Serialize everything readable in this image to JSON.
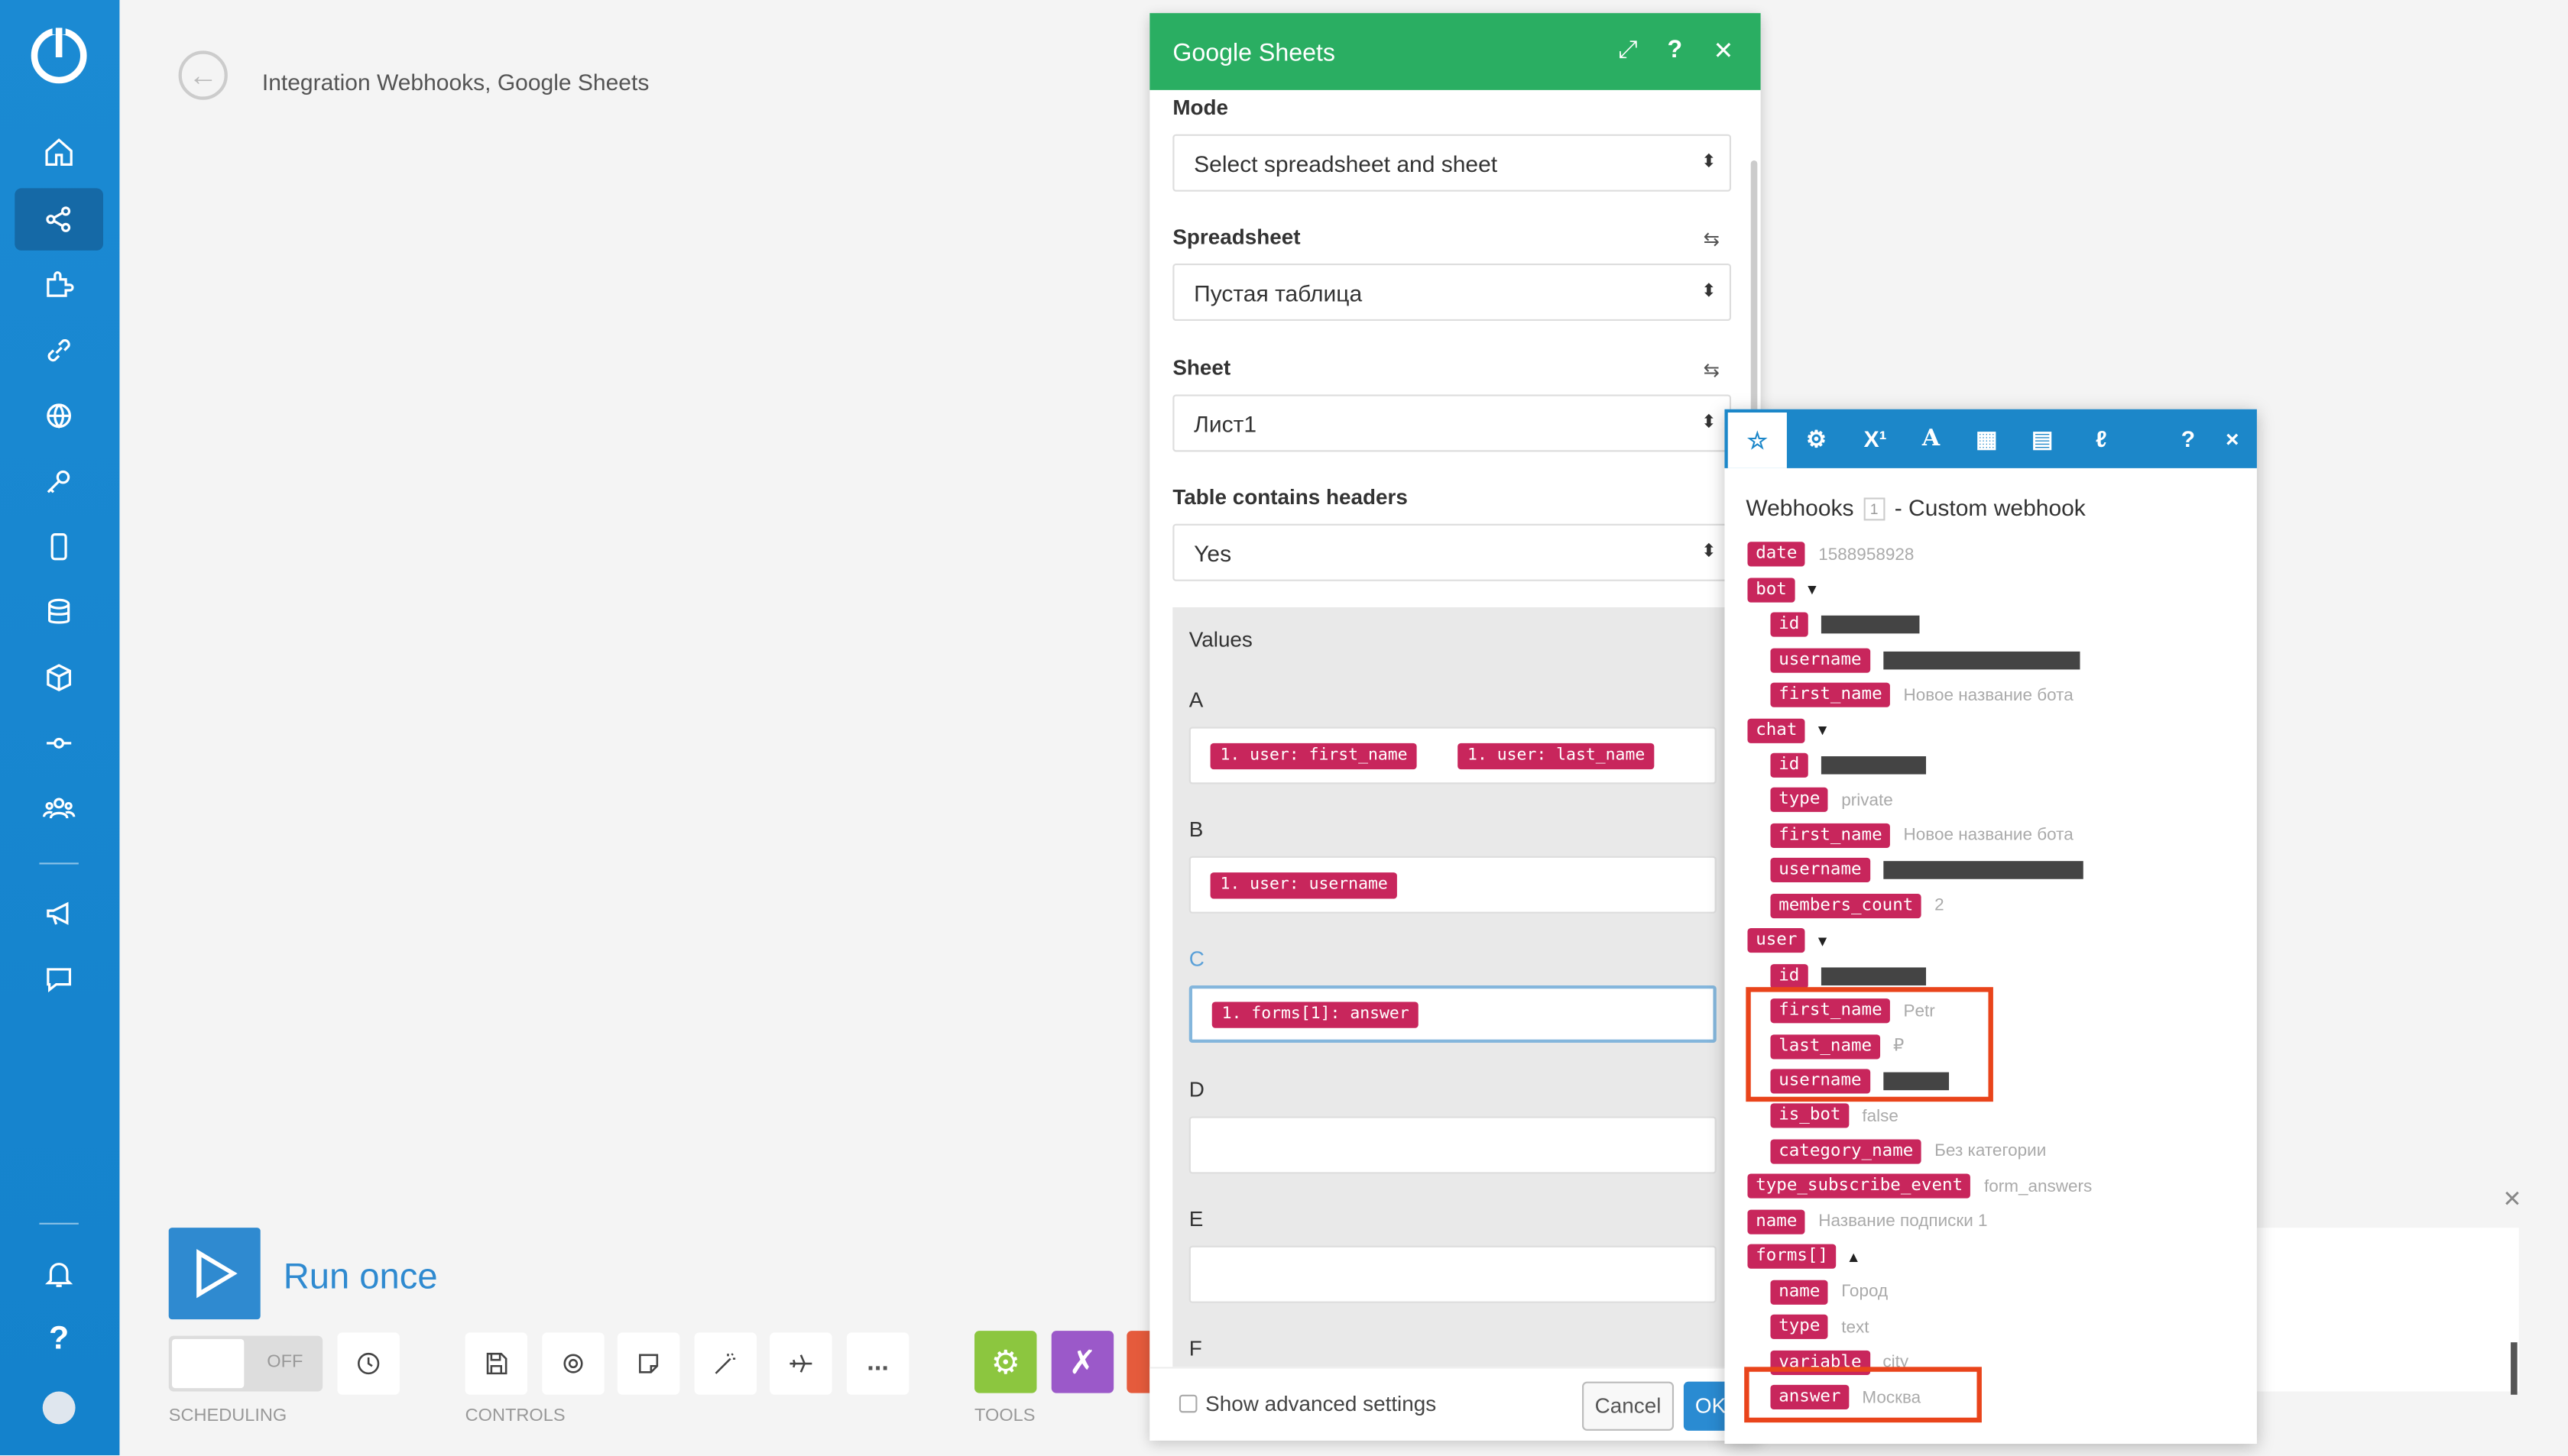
{
  "breadcrumb": "Integration Webhooks, Google Sheets",
  "sidebar": {
    "items": [
      "home-icon",
      "share-icon",
      "puzzle-icon",
      "link-icon",
      "globe-icon",
      "key-icon",
      "device-icon",
      "database-icon",
      "cube-icon",
      "flow-icon",
      "team-icon",
      "megaphone-icon",
      "chat-icon",
      "bell-icon",
      "help-icon",
      "avatar-icon"
    ],
    "help_label": "?"
  },
  "run": {
    "label": "Run once"
  },
  "scheduling": {
    "toggle": "OFF",
    "label": "SCHEDULING"
  },
  "controls": {
    "label": "CONTROLS",
    "more": "..."
  },
  "tools": {
    "label": "TOOLS"
  },
  "panel": {
    "title": "Google Sheets",
    "fields": {
      "mode_label": "Mode",
      "mode_value": "Select spreadsheet and sheet",
      "spreadsheet_label": "Spreadsheet",
      "spreadsheet_value": "Пустая таблица",
      "sheet_label": "Sheet",
      "sheet_value": "Лист1",
      "headers_label": "Table contains headers",
      "headers_value": "Yes"
    },
    "values_label": "Values",
    "columns": [
      {
        "letter": "A",
        "pills": [
          "1. user: first_name",
          "1. user: last_name"
        ]
      },
      {
        "letter": "B",
        "pills": [
          "1. user: username"
        ]
      },
      {
        "letter": "C",
        "pills": [
          "1. forms[1]: answer"
        ]
      },
      {
        "letter": "D",
        "pills": []
      },
      {
        "letter": "E",
        "pills": []
      },
      {
        "letter": "F",
        "pills": []
      }
    ],
    "advanced_label": "Show advanced settings",
    "cancel_label": "Cancel",
    "ok_label": "OK"
  },
  "popup": {
    "tabs": [
      "star-icon",
      "gear-icon",
      "superscript-icon",
      "text-icon",
      "calendar-icon",
      "table-icon",
      "math-icon"
    ],
    "superscript": "X¹",
    "text_tab": "A",
    "help": "?",
    "close": "×",
    "title_pre": "Webhooks",
    "title_num": "1",
    "title_post": "- Custom webhook",
    "rows": [
      {
        "key": "date",
        "value": "1588958928",
        "indent": 0
      },
      {
        "key": "bot",
        "caret": "▼",
        "indent": 0
      },
      {
        "key": "id",
        "redact": 60,
        "indent": 1
      },
      {
        "key": "username",
        "redact": 120,
        "indent": 1
      },
      {
        "key": "first_name",
        "value": "Новое название бота",
        "indent": 1
      },
      {
        "key": "chat",
        "caret": "▼",
        "indent": 0
      },
      {
        "key": "id",
        "redact": 64,
        "indent": 1
      },
      {
        "key": "type",
        "value": "private",
        "indent": 1
      },
      {
        "key": "first_name",
        "value": "Новое название бота",
        "indent": 1
      },
      {
        "key": "username",
        "redact": 122,
        "indent": 1
      },
      {
        "key": "members_count",
        "value": "2",
        "indent": 1
      },
      {
        "key": "user",
        "caret": "▼",
        "indent": 0
      },
      {
        "key": "id",
        "redact": 64,
        "indent": 1
      },
      {
        "key": "first_name",
        "value": "Petr",
        "indent": 1
      },
      {
        "key": "last_name",
        "value": "₽",
        "indent": 1
      },
      {
        "key": "username",
        "redact": 40,
        "indent": 1
      },
      {
        "key": "is_bot",
        "value": "false",
        "indent": 1
      },
      {
        "key": "category_name",
        "value": "Без категории",
        "indent": 1
      },
      {
        "key": "type_subscribe_event",
        "value": "form_answers",
        "indent": 0
      },
      {
        "key": "name",
        "value": "Название подписки 1",
        "indent": 0
      },
      {
        "key": "forms[]",
        "caret": "▲",
        "indent": 0
      },
      {
        "key": "name",
        "value": "Город",
        "indent": 1
      },
      {
        "key": "type",
        "value": "text",
        "indent": 1
      },
      {
        "key": "variable",
        "value": "city",
        "indent": 1
      },
      {
        "key": "answer",
        "value": "Москва",
        "indent": 1
      }
    ]
  },
  "colors": {
    "sidebar": "#1b8ad3",
    "header_green": "#2aae62",
    "pill": "#c8265c",
    "highlight": "#e9441b",
    "popup_bar": "#1c87c9"
  }
}
